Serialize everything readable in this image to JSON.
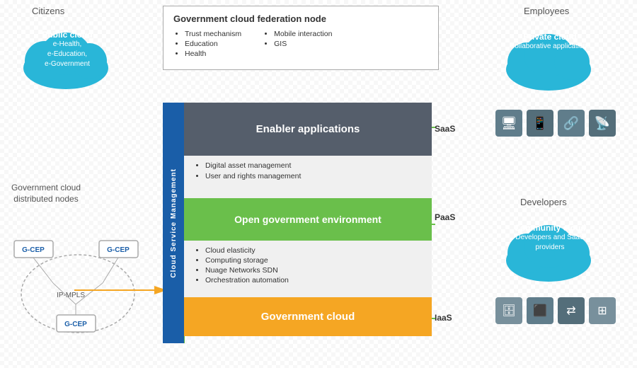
{
  "citizens": {
    "label": "Citizens",
    "cloud": {
      "title": "Public cloud",
      "items": [
        "e-Health,",
        "e-Education,",
        "e-Government"
      ]
    }
  },
  "employees": {
    "label": "Employees",
    "cloud": {
      "title": "Private cloud",
      "subtitle": "Collaborative applications"
    }
  },
  "developers": {
    "label": "Developers",
    "cloud": {
      "title": "Community cloud",
      "subtitle": "Developers and SaaS providers"
    }
  },
  "federation": {
    "title": "Government cloud federation node",
    "col1": [
      "Trust mechanism",
      "Education",
      "Health"
    ],
    "col2": [
      "Mobile interaction",
      "GIS"
    ]
  },
  "csm": {
    "label": "Cloud Service Management"
  },
  "layers": {
    "saas": {
      "title": "Enabler applications",
      "label": "SaaS",
      "items": [
        "Digital asset management",
        "User and rights management"
      ]
    },
    "paas": {
      "title": "Open government environment",
      "label": "PaaS",
      "items": [
        "Cloud elasticity",
        "Computing storage",
        "Nuage Networks SDN",
        "Orchestration automation"
      ]
    },
    "iaas": {
      "title": "Government cloud",
      "label": "IaaS"
    }
  },
  "distributed_nodes": {
    "label": "Government cloud distributed nodes",
    "nodes": [
      "G-CEP",
      "G-CEP",
      "G-CEP"
    ],
    "ip_mpls": "IP-MPLS"
  },
  "icons": {
    "saas_icons": [
      "monitor",
      "tablet",
      "network",
      "wifi"
    ],
    "iaas_icons": [
      "database",
      "server",
      "transfer",
      "grid"
    ]
  }
}
